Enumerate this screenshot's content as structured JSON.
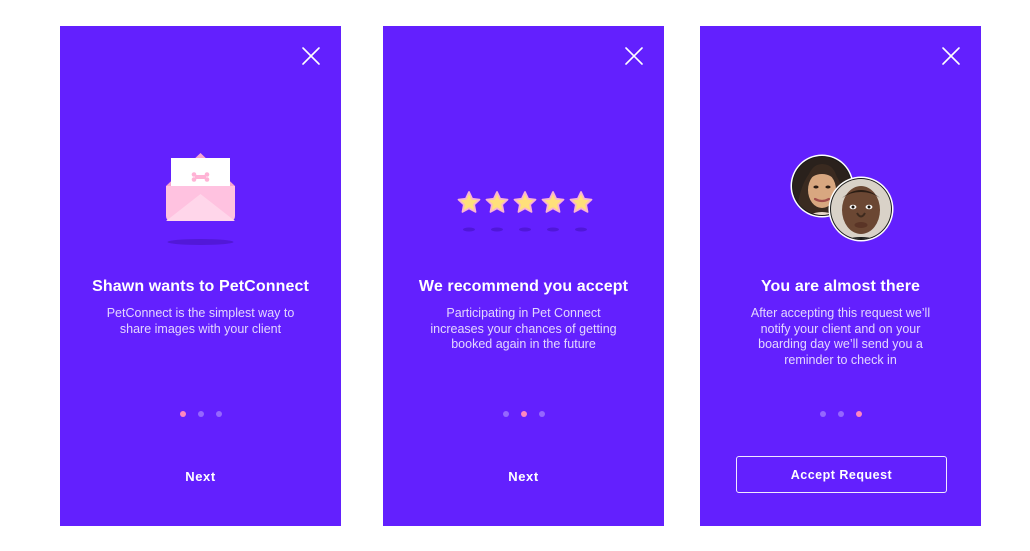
{
  "colors": {
    "background": "#6320fe",
    "accent_dot": "#ff86bf",
    "envelope": "#ffbfe0",
    "star": "#ffe07a"
  },
  "screens": [
    {
      "illustration": "envelope-with-letter",
      "title": "Shawn wants to PetConnect",
      "description": "PetConnect is the simplest way to share images with your client",
      "active_dot": 1,
      "button_label": "Next"
    },
    {
      "illustration": "five-stars",
      "title": "We recommend you accept",
      "description": "Participating in Pet Connect increases your chances of getting booked again in the future",
      "active_dot": 3,
      "button_label": "Next"
    },
    {
      "illustration": "two-avatars",
      "title": "You are almost there",
      "description": "After accepting this request we’ll notify your client and on your boarding day we’ll send you a reminder to check in",
      "active_dot": 3,
      "button_label": "Accept Request"
    }
  ]
}
